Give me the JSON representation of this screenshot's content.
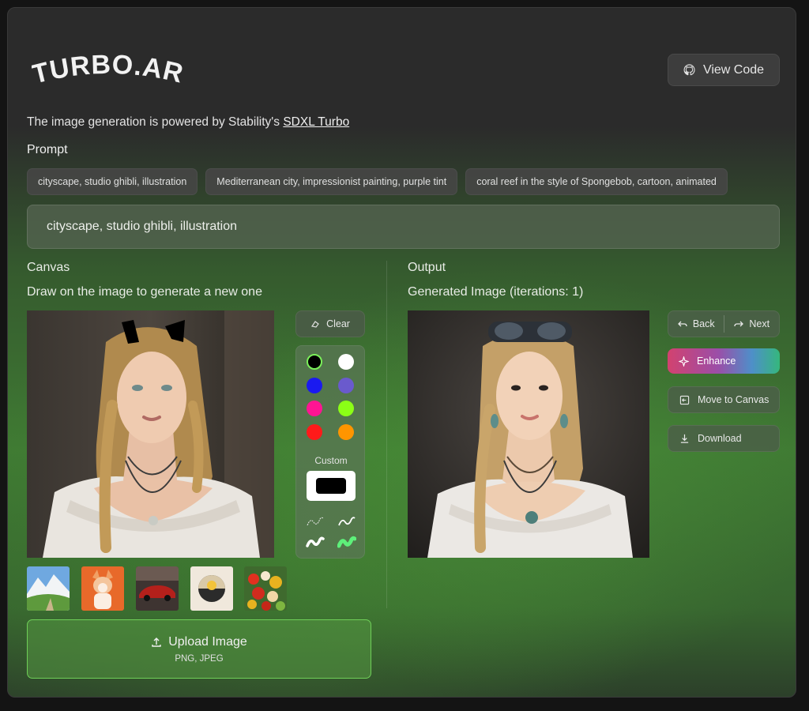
{
  "header": {
    "logo_text": "TURBO.ART",
    "view_code_label": "View Code"
  },
  "intro": {
    "powered_text": "The image generation is powered by Stability's ",
    "powered_link": "SDXL Turbo"
  },
  "prompt": {
    "label": "Prompt",
    "suggestions": [
      "cityscape, studio ghibli, illustration",
      "Mediterranean city, impressionist painting, purple tint",
      "coral reef in the style of Spongebob, cartoon, animated"
    ],
    "value": "cityscape, studio ghibli, illustration"
  },
  "canvas": {
    "title": "Canvas",
    "subtitle": "Draw on the image to generate a new one",
    "clear_label": "Clear",
    "colors": [
      "#000000",
      "#ffffff",
      "#1a1af0",
      "#6a5acd",
      "#ff1493",
      "#8bff16",
      "#ff1a1a",
      "#ff9500"
    ],
    "selected_color": "#000000",
    "custom_label": "Custom",
    "custom_color": "#000000",
    "brushes": [
      "thin-outline-brush",
      "thin-solid-brush",
      "thick-white-brush",
      "thick-green-brush"
    ],
    "thumbnails": [
      "mountain-landscape",
      "corgi-dog",
      "red-car",
      "sunset-circle",
      "fruit-bowl"
    ],
    "upload_label": "Upload Image",
    "upload_formats": "PNG, JPEG"
  },
  "output": {
    "title": "Output",
    "subtitle": "Generated Image (iterations: 1)",
    "back_label": "Back",
    "next_label": "Next",
    "enhance_label": "Enhance",
    "move_label": "Move to Canvas",
    "download_label": "Download"
  }
}
